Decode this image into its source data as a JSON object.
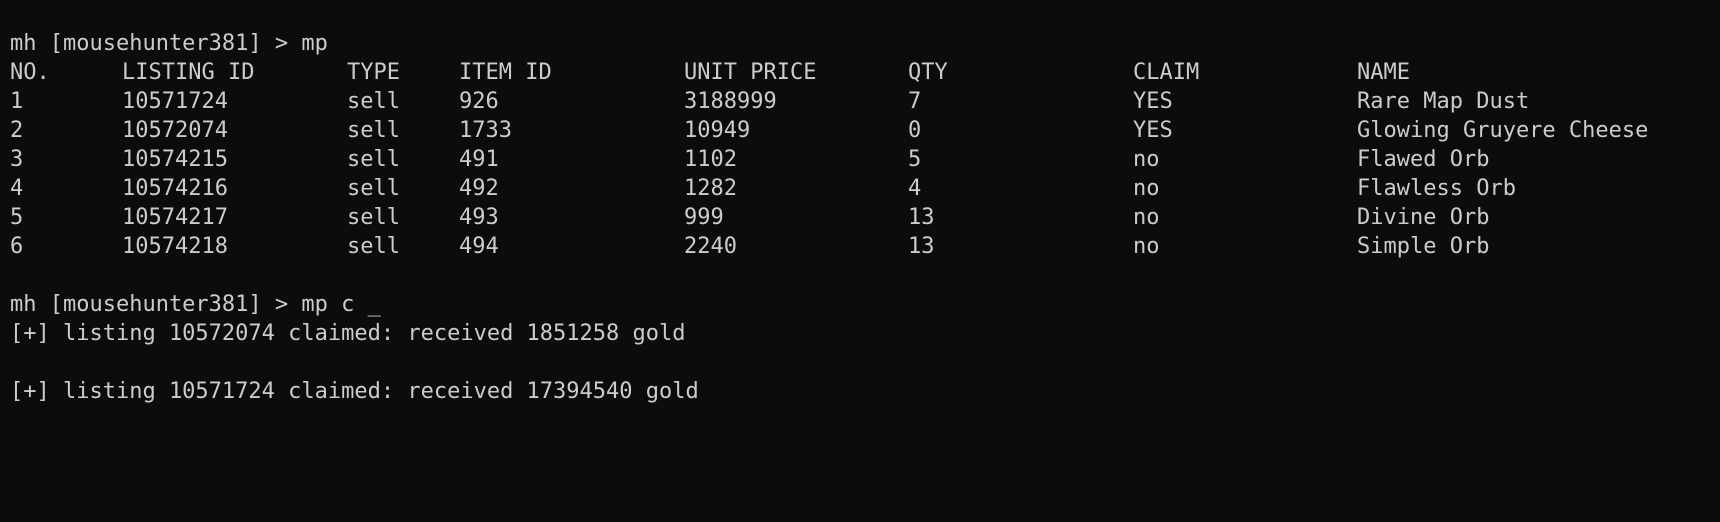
{
  "prompt1": {
    "prompt": "mh [mousehunter381] > ",
    "command": "mp"
  },
  "table": {
    "headers": [
      "NO.",
      "LISTING ID",
      "TYPE",
      "ITEM ID",
      "UNIT PRICE",
      "QTY",
      "CLAIM",
      "NAME"
    ],
    "rows": [
      [
        "1",
        "10571724",
        "sell",
        "926",
        "3188999",
        "7",
        "YES",
        "Rare Map Dust"
      ],
      [
        "2",
        "10572074",
        "sell",
        "1733",
        "10949",
        "0",
        "YES",
        "Glowing Gruyere Cheese"
      ],
      [
        "3",
        "10574215",
        "sell",
        "491",
        "1102",
        "5",
        "no",
        "Flawed Orb"
      ],
      [
        "4",
        "10574216",
        "sell",
        "492",
        "1282",
        "4",
        "no",
        "Flawless Orb"
      ],
      [
        "5",
        "10574217",
        "sell",
        "493",
        "999",
        "13",
        "no",
        "Divine Orb"
      ],
      [
        "6",
        "10574218",
        "sell",
        "494",
        "2240",
        "13",
        "no",
        "Simple Orb"
      ]
    ]
  },
  "prompt2": {
    "prompt": "mh [mousehunter381] > ",
    "command": "mp c _"
  },
  "output": [
    "[+] listing 10572074 claimed: received 1851258 gold",
    "[+] listing 10571724 claimed: received 17394540 gold"
  ]
}
